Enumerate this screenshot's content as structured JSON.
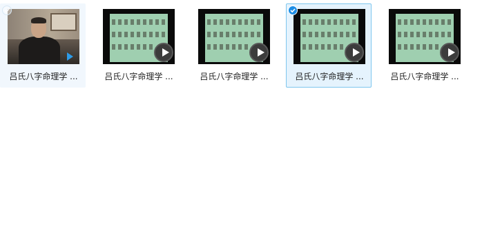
{
  "files": [
    {
      "name": "吕氏八字命理学 ...",
      "state": "hovered",
      "thumbnail": "person-video-frame",
      "play_icon": "blue-play-icon",
      "checked": false
    },
    {
      "name": "吕氏八字命理学 ...",
      "state": "normal",
      "thumbnail": "text-slide-frame",
      "play_icon": "play-circle-icon",
      "checked": false
    },
    {
      "name": "吕氏八字命理学 ...",
      "state": "normal",
      "thumbnail": "text-slide-frame",
      "play_icon": "play-circle-icon",
      "checked": false
    },
    {
      "name": "吕氏八字命理学 ...",
      "state": "selected",
      "thumbnail": "text-slide-frame",
      "play_icon": "play-circle-icon",
      "checked": true
    },
    {
      "name": "吕氏八字命理学 ...",
      "state": "normal",
      "thumbnail": "text-slide-frame",
      "play_icon": "play-circle-icon",
      "checked": false
    }
  ],
  "colors": {
    "selection_border": "#7ec6ee",
    "selection_fill": "#e5f3fd",
    "hover_fill": "#f1f7fd",
    "check_blue": "#1d8ee6",
    "slide_green": "#9fcfb0"
  }
}
